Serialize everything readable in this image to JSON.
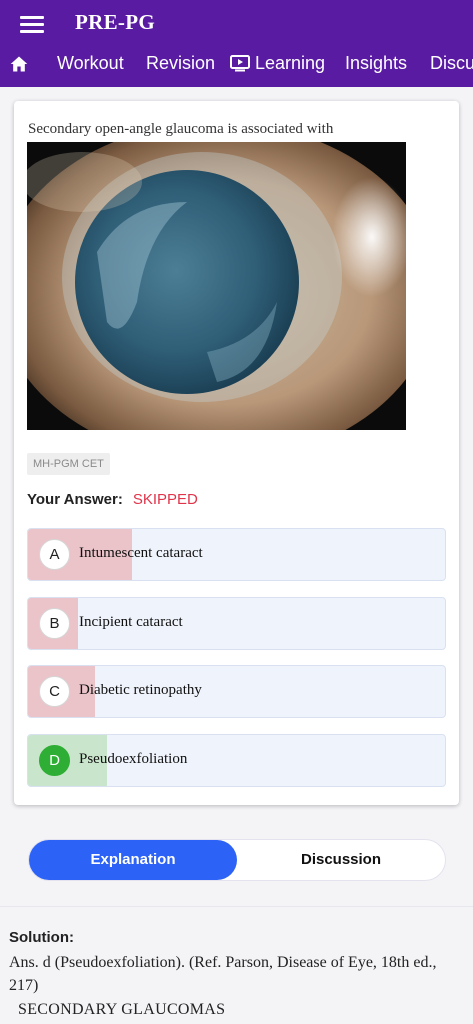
{
  "app": {
    "title": "PRE-PG"
  },
  "nav": {
    "tabs": [
      {
        "label": "Workout"
      },
      {
        "label": "Revision"
      },
      {
        "label": "Learning"
      },
      {
        "label": "Insights"
      },
      {
        "label": "Discu"
      }
    ]
  },
  "question": {
    "text": "Secondary open-angle glaucoma is associated with",
    "tag": "MH-PGM CET",
    "your_answer_label": "Your Answer:",
    "your_answer_value": "SKIPPED",
    "options": [
      {
        "letter": "A",
        "text": "Intumescent cataract",
        "percent": 25,
        "state": "wrong"
      },
      {
        "letter": "B",
        "text": "Incipient cataract",
        "percent": 12,
        "state": "wrong"
      },
      {
        "letter": "C",
        "text": "Diabetic retinopathy",
        "percent": 16,
        "state": "wrong"
      },
      {
        "letter": "D",
        "text": "Pseudoexfoliation",
        "percent": 19,
        "state": "right"
      }
    ]
  },
  "toggle": {
    "explanation": "Explanation",
    "discussion": "Discussion"
  },
  "solution": {
    "label": "Solution:",
    "text": "Ans. d (Pseudoexfoliation). (Ref. Parson, Disease of Eye, 18th ed., 217)",
    "heading": "SECONDARY GLAUCOMAS"
  },
  "colors": {
    "header": "#5a1ba3",
    "accent": "#2d62f6",
    "skipped": "#e0344a",
    "correct": "#2eae34"
  }
}
